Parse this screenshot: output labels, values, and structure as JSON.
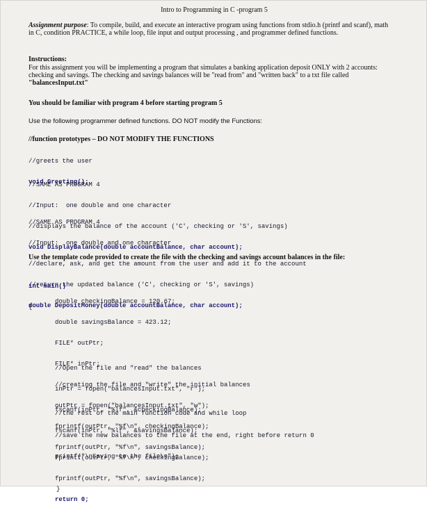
{
  "header": {
    "title": "Intro to Programming in C -program 5"
  },
  "purpose": {
    "label": "Assignment purpose",
    "text": ": To compile, build, and execute an interactive program using functions from stdio.h (printf and scanf), math in C, condition PRACTICE, a while loop, file input and output processing , and programmer defined functions."
  },
  "instructions": {
    "heading": "Instructions:",
    "text_1": "For this assignment you will be implementing a program that simulates a banking application deposit ONLY with 2 accounts: checking and savings. The checking and savings balances will be \"read from\" and \"written back\" to a txt file called ",
    "filename": "\"balancesInput.txt\""
  },
  "familiar_note": "You should be familiar with program 4 before starting program 5",
  "use_functions_note": "Use the following programmer defined functions. DO NOT modify the Functions:",
  "prototypes_heading": "//function prototypes – DO NOT MODIFY THE FUNCTIONS",
  "code_block_1": [
    "//greets the user",
    "void Greeting();"
  ],
  "code_block_2": [
    "//SAME AS PROGRAM 4",
    "//Input:  one double and one character",
    "//displays the balance of the account ('C', checking or 'S', savings)",
    "void DisplayBalance(double accountBalance, char account);"
  ],
  "code_block_3": [
    "//SAME AS PROGRAM 4",
    "//Input:  one double and one character",
    "//declare, ask, and get the amount from the user and add it to the account",
    "//return the updated balance ('C', checking or 'S', savings)",
    "double DepositMoney(double accountBalance, char account);"
  ],
  "template_note": "Use the template code provided to create the file with the checking and savings account balances in the file:",
  "main_head": [
    "int main()",
    "{"
  ],
  "main_part_1": [
    "double checkingBalance = 120.67;",
    "double savingsBalance = 423.12;",
    "FILE* outPtr;",
    "FILE* inPtr;",
    "//creating the file and \"write\" the initial balances",
    "outPtr = fopen(\"balancesInput.txt\", \"w\");",
    "fprintf(outPtr, \"%f\\n\", checkingBalance);",
    "fprintf(outPtr, \"%f\\n\", savingsBalance);"
  ],
  "main_part_2": [
    "//Open the file and \"read\" the balances",
    "inPtr = fopen(\"balancesInput.txt\", \"r\");",
    "fscanf(inPtr, \"%lf\", &checkingBalance);",
    "fscanf(inPtr, \"%lf\", &savingsBalance);"
  ],
  "main_part_3": [
    "//the rest of the main function code and while loop"
  ],
  "main_part_4": [
    "//save the new balances to the file at the end, right before return 0",
    "printf(\"\\nSaving to the file\\n\");"
  ],
  "main_part_5": [
    "fprintf(outPtr, \"%f\\n\", checkingBalance);",
    "fprintf(outPtr, \"%f\\n\", savingsBalance);",
    "return 0;"
  ],
  "main_close": [
    "}"
  ]
}
